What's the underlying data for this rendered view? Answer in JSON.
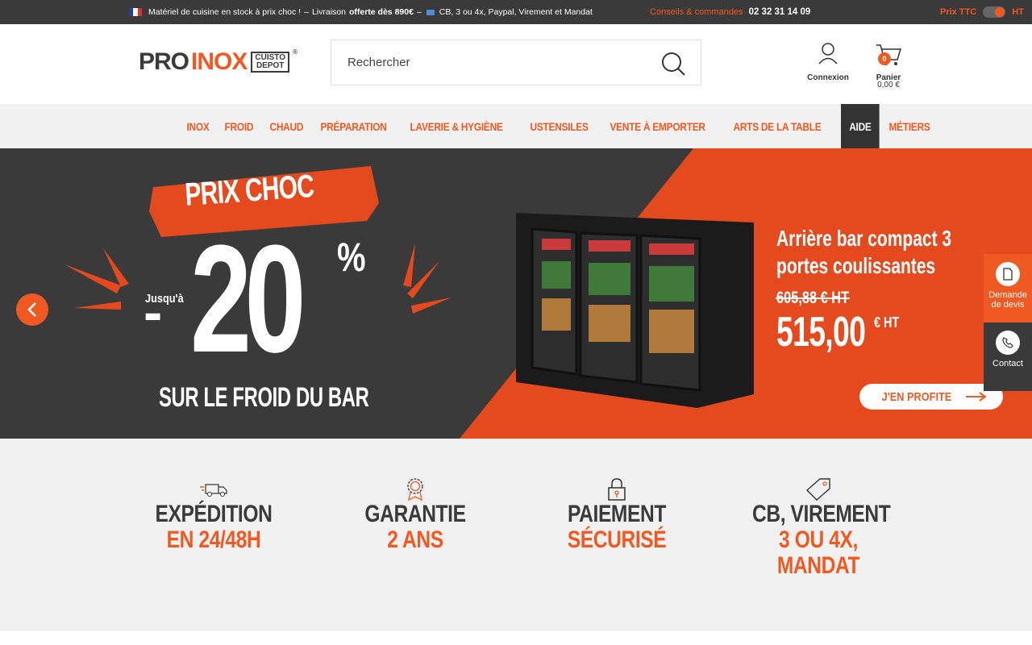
{
  "topbar": {
    "promo_text": "Matériel de cuisine en stock à prix choc !",
    "sep1": "–",
    "delivery_text": "Livraison",
    "delivery_bold": "offerte dès 890€",
    "sep2": "–",
    "payment_text": "CB, 3 ou 4x, Paypal, Virement et Mandat",
    "advice_label": "Conseils & commandes",
    "phone": "02 32 31 14 09",
    "price_ttc_label": "Prix TTC",
    "price_ht_label": "HT"
  },
  "header": {
    "logo_pro": "PRO",
    "logo_inox": "INOX",
    "logo_cuisto": "CUISTO",
    "logo_depot": "DEPOT",
    "logo_reg": "®",
    "search_placeholder": "Rechercher",
    "login_label": "Connexion",
    "cart_label": "Panier",
    "cart_count": "0",
    "cart_total": "0,00 €"
  },
  "nav": {
    "items": [
      "INOX",
      "FROID",
      "CHAUD",
      "PRÉPARATION",
      "LAVERIE & HYGIÈNE",
      "USTENSILES",
      "VENTE À EMPORTER",
      "ARTS DE LA TABLE",
      "AIDE",
      "MÉTIERS"
    ],
    "active": "AIDE"
  },
  "hero": {
    "badge": "PRIX CHOC",
    "upto": "Jusqu'à",
    "minus": "-",
    "discount": "20",
    "percent": "%",
    "subtitle": "SUR LE FROID DU BAR",
    "product_line1": "Arrière bar compact 3",
    "product_line2": "portes coulissantes",
    "old_price": "605,88 € HT",
    "new_price": "515,00",
    "new_price_suffix": "€ HT",
    "cta": "J'EN PROFITE"
  },
  "side": {
    "devis_line1": "Demande",
    "devis_line2": "de devis",
    "contact": "Contact"
  },
  "features": [
    {
      "icon": "truck-icon",
      "line1": "EXPÉDITION",
      "line2": "EN 24/48H",
      "line3": ""
    },
    {
      "icon": "award-icon",
      "line1": "GARANTIE",
      "line2": "2 ANS",
      "line3": ""
    },
    {
      "icon": "lock-icon",
      "line1": "PAIEMENT",
      "line2": "SÉCURISÉ",
      "line3": ""
    },
    {
      "icon": "tag-icon",
      "line1": "CB, VIREMENT",
      "line2": "3 OU 4X,",
      "line3": "MANDAT"
    }
  ],
  "colors": {
    "accent": "#f05a22",
    "dark": "#3a3a3a",
    "light_bg": "#f1f1f1"
  }
}
